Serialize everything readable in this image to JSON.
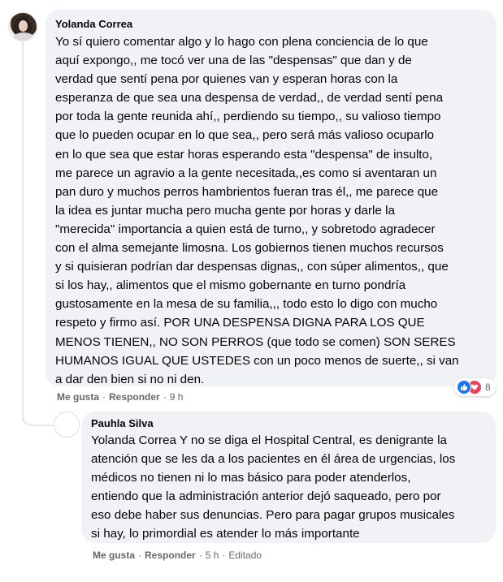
{
  "comment": {
    "author": "Yolanda Correa",
    "lines": [
      "Yo sí quiero comentar algo y lo hago con plena conciencia de lo que",
      "aquí expongo,, me tocó ver una de las \"despensas\" que dan y de",
      "verdad que sentí pena por quienes van y esperan horas con la",
      "esperanza de que sea una despensa de verdad,, de verdad sentí pena",
      "por toda la gente reunida ahí,, perdiendo su tiempo,, su valioso tiempo",
      "que lo pueden ocupar en lo que sea,, pero será más valioso ocuparlo",
      "en lo que sea que estar horas esperando esta \"despensa\" de insulto,",
      "me parece un agravio a la gente necesitada,,es como si aventaran un",
      "pan duro y muchos perros hambrientos fueran tras él,, me parece que",
      "la idea es juntar mucha pero mucha gente por horas y darle la",
      "\"merecida\" importancia a quien está de turno,, y sobretodo agradecer",
      "con el alma semejante limosna. Los gobiernos tienen muchos recursos",
      "y si quisieran podrían dar despensas dignas,, con súper alimentos,, que",
      "si los hay,, alimentos que el mismo gobernante en turno pondría",
      "gustosamente en la mesa de su familia,,, todo esto lo digo con mucho",
      "respeto y firmo así. POR UNA DESPENSA DIGNA PARA LOS QUE",
      "MENOS TIENEN,, NO SON PERROS (que todo se comen) SON SERES",
      "HUMANOS IGUAL QUE USTEDES con un poco menos de suerte,, si van",
      "a dar den bien si no ni den."
    ],
    "like_label": "Me gusta",
    "reply_label": "Responder",
    "time": "9 h",
    "reaction_count": "8",
    "reaction_icons": [
      "like-icon",
      "love-icon"
    ],
    "colors": {
      "like": "#1877f2",
      "love": "#f33e58"
    }
  },
  "reply": {
    "author": "Pauhla Silva",
    "lines": [
      "Yolanda Correa Y no se diga el Hospital Central, es denigrante la",
      "atención que se les da a los pacientes en él área de urgencias, los",
      "médicos no tienen ni lo mas básico para poder atenderlos,",
      "entiendo que la administración anterior dejó saqueado, pero por",
      "eso debe haber sus denuncias. Pero para pagar grupos musicales",
      "si hay, lo primordial es atender lo más importante"
    ],
    "like_label": "Me gusta",
    "reply_label": "Responder",
    "time": "5 h",
    "edited_label": "Editado"
  },
  "separator": "·"
}
